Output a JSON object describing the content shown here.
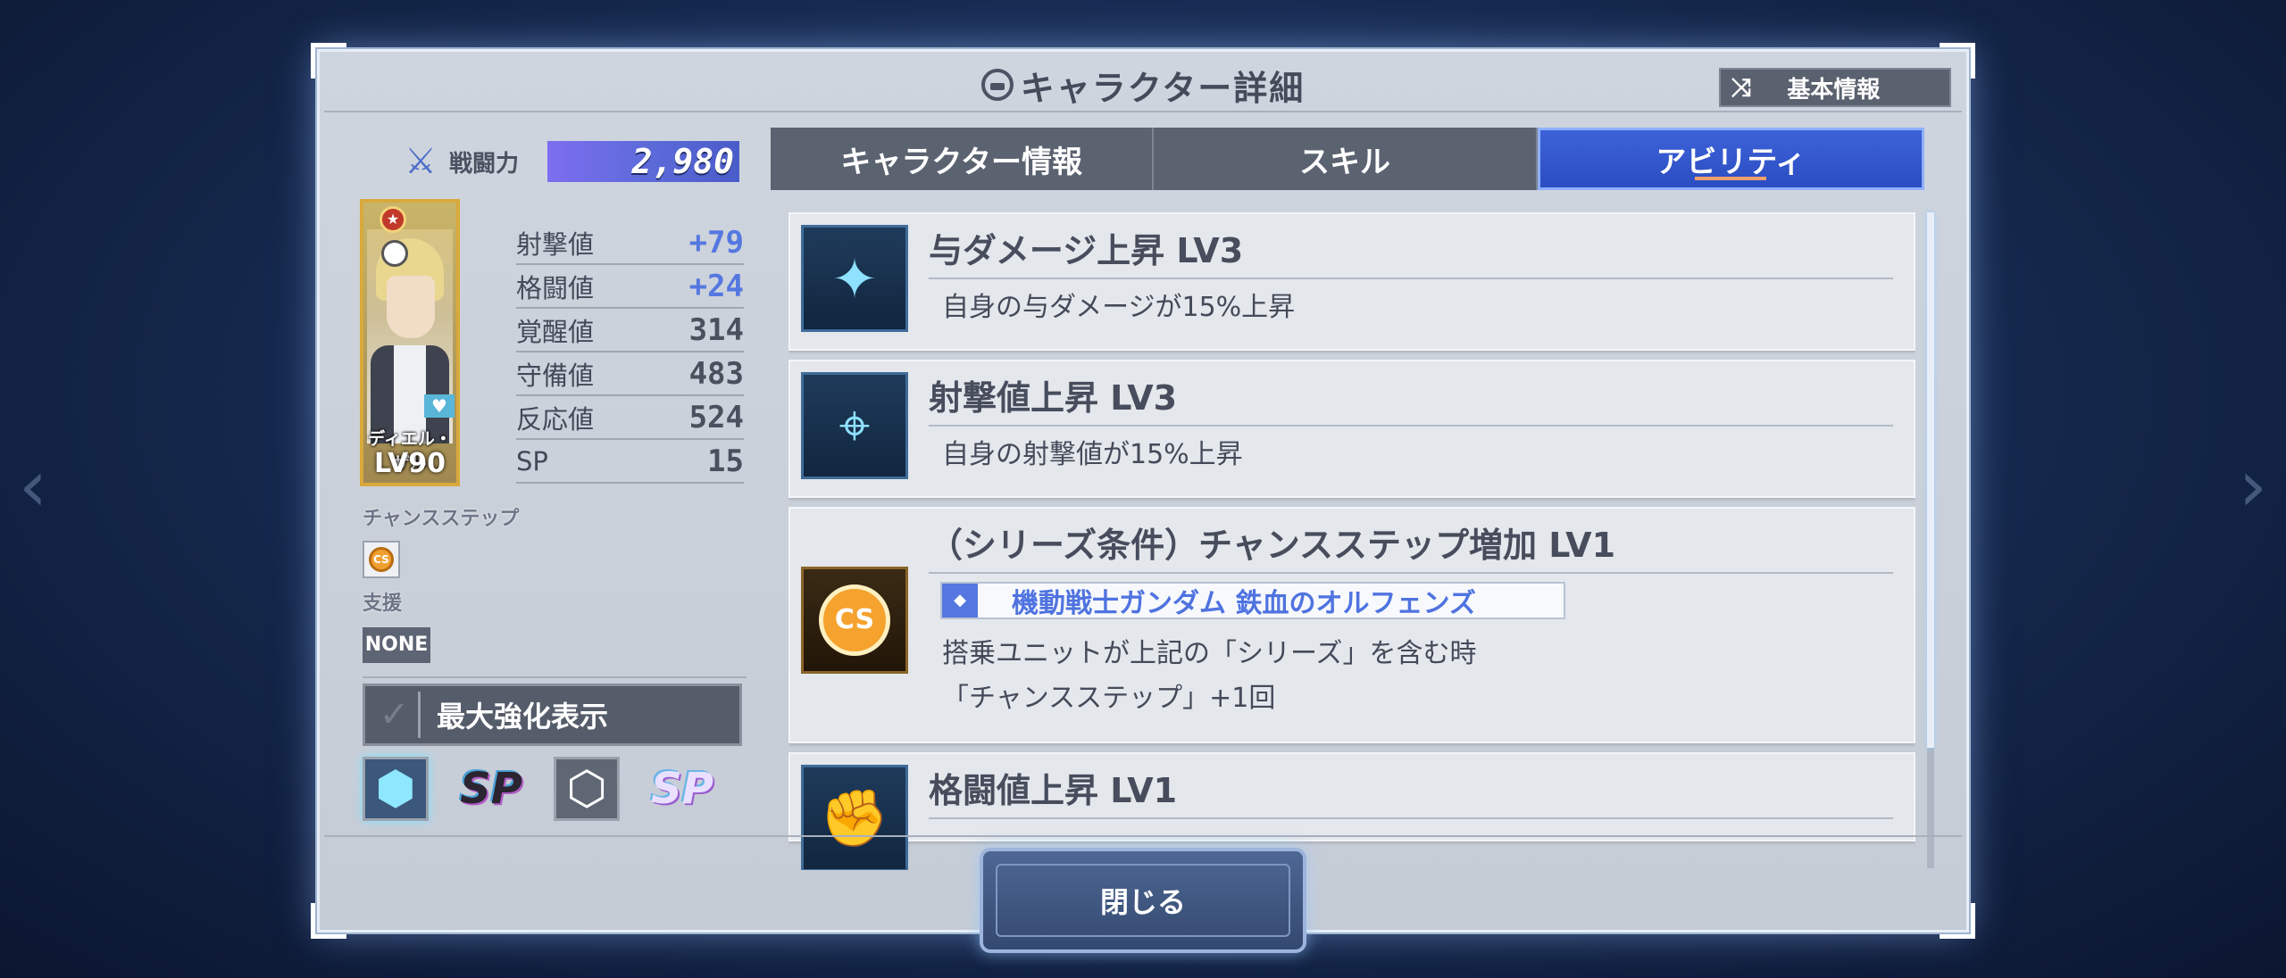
{
  "header": {
    "title": "キャラクター詳細",
    "basic_info_button": "基本情報"
  },
  "character": {
    "power_label": "戦闘力",
    "power_value": "2,980",
    "name": "ディエル・ザル",
    "level": "LV90",
    "stats": [
      {
        "label": "射撃値",
        "value": "+79",
        "boosted": true
      },
      {
        "label": "格闘値",
        "value": "+24",
        "boosted": true
      },
      {
        "label": "覚醒値",
        "value": "314",
        "boosted": false
      },
      {
        "label": "守備値",
        "value": "483",
        "boosted": false
      },
      {
        "label": "反応値",
        "value": "524",
        "boosted": false
      },
      {
        "label": "SP",
        "value": "15",
        "boosted": false
      }
    ],
    "chance_step_label": "チャンスステップ",
    "chance_step_icon": "CS",
    "support_label": "支援",
    "support_value": "NONE",
    "max_enhance_label": "最大強化表示",
    "sp_badge": "SP"
  },
  "tabs": [
    {
      "label": "キャラクター情報",
      "active": false
    },
    {
      "label": "スキル",
      "active": false
    },
    {
      "label": "アビリティ",
      "active": true
    }
  ],
  "abilities": [
    {
      "title": "与ダメージ上昇 LV3",
      "description": "自身の与ダメージが15%上昇",
      "icon": "damage-up-icon"
    },
    {
      "title": "射撃値上昇 LV3",
      "description": "自身の射撃値が15%上昇",
      "icon": "shooting-up-icon"
    },
    {
      "title": "（シリーズ条件）チャンスステップ増加 LV1",
      "series": "機動戦士ガンダム 鉄血のオルフェンズ",
      "description_line1": "搭乗ユニットが上記の「シリーズ」を含む時",
      "description_line2": "「チャンスステップ」+1回",
      "icon": "chance-step-icon",
      "icon_text": "CS"
    },
    {
      "title": "格闘値上昇 LV1",
      "icon": "melee-up-icon"
    }
  ],
  "footer": {
    "close_button": "閉じる"
  }
}
